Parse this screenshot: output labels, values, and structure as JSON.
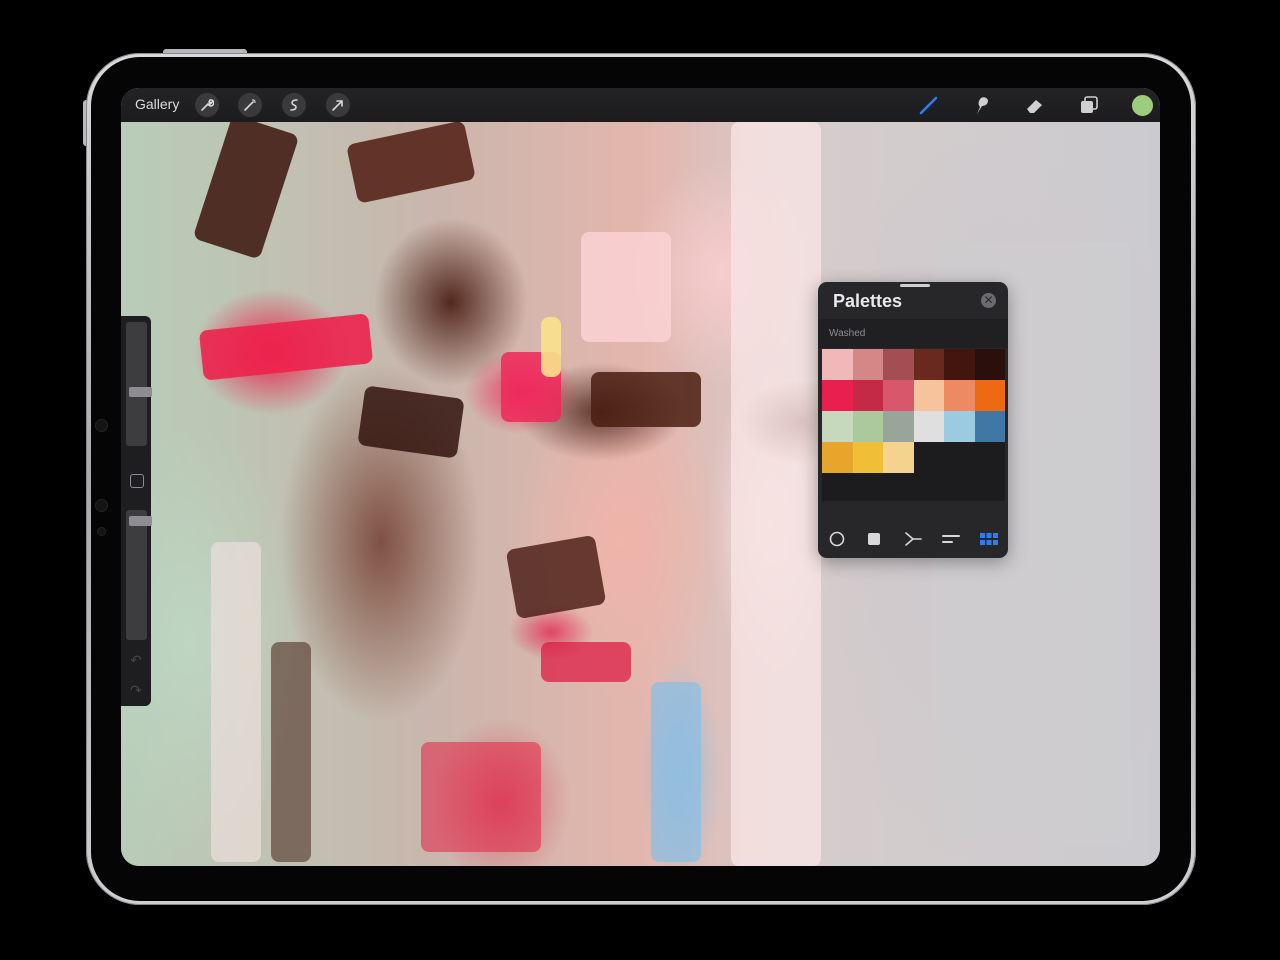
{
  "toolbar": {
    "gallery_label": "Gallery",
    "left_tools": [
      "wrench-icon",
      "magic-wand-icon",
      "selection-icon",
      "transform-icon"
    ],
    "right_tools": [
      "brush-icon",
      "smudge-icon",
      "eraser-icon",
      "layers-icon"
    ],
    "active_tool": "brush-icon",
    "active_color": "#9ccc7c",
    "accent": "#2e7cf6"
  },
  "sidebar": {
    "brush_size_level": 0.15,
    "opacity_level": 0.05
  },
  "palettes": {
    "title": "Palettes",
    "close_icon": "close-icon",
    "palette_name": "Washed",
    "swatches": [
      "#f0b8b8",
      "#d48786",
      "#a44d52",
      "#6a291f",
      "#42150e",
      "#2a100c",
      "#e81f4f",
      "#c42945",
      "#d9576b",
      "#f5c39c",
      "#ee8a63",
      "#ed6a12",
      "#c6d9bd",
      "#acc99e",
      "#9aa59a",
      "#dfdfdf",
      "#9acbe0",
      "#3f78a4",
      "#e8a52c",
      "#f1be37",
      "#f4d38e"
    ],
    "footer_modes": [
      "disc-icon",
      "classic-icon",
      "harmony-icon",
      "value-icon",
      "palettes-icon"
    ],
    "active_mode": "palettes-icon"
  }
}
